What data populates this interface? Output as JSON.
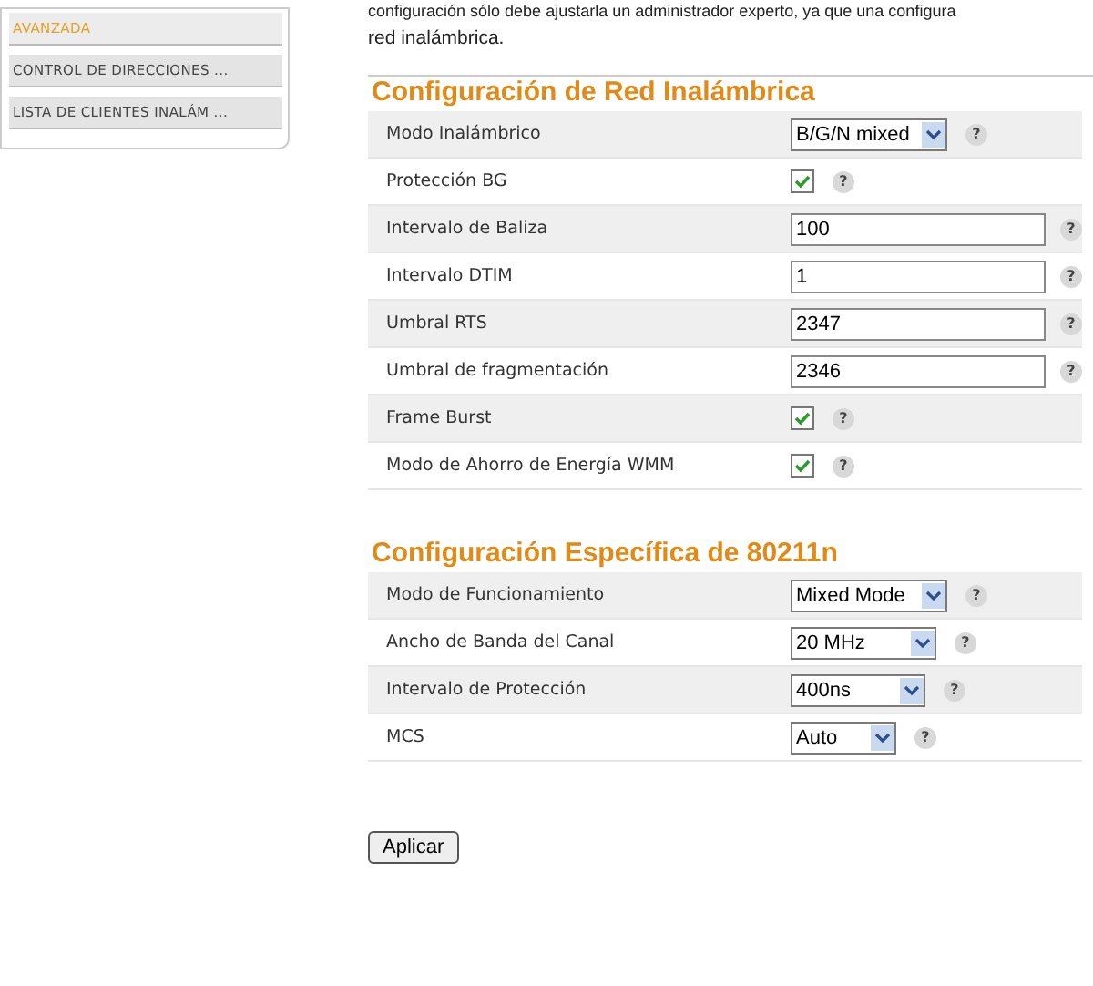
{
  "sidebar": {
    "items": [
      {
        "label": "AVANZADA",
        "selected": true
      },
      {
        "label": "CONTROL DE DIRECCIONES ...",
        "selected": false
      },
      {
        "label": "LISTA DE CLIENTES INALÁM ...",
        "selected": false
      }
    ]
  },
  "intro": {
    "lines": [
      "configuración sólo debe ajustarla un administrador experto, ya que una configura",
      "red inalámbrica."
    ]
  },
  "sections": [
    {
      "title": "Configuración de Red Inalámbrica",
      "rows": [
        {
          "label": "Modo Inalámbrico",
          "kind": "select",
          "value": "B/G/N mixed",
          "help": "?"
        },
        {
          "label": "Protección BG",
          "kind": "checkbox",
          "checked": true,
          "help": "?"
        },
        {
          "label": "Intervalo de Baliza",
          "kind": "input",
          "value": "100",
          "help": "?"
        },
        {
          "label": "Intervalo DTIM",
          "kind": "input",
          "value": "1",
          "help": "?"
        },
        {
          "label": "Umbral RTS",
          "kind": "input",
          "value": "2347",
          "help": "?"
        },
        {
          "label": "Umbral de fragmentación",
          "kind": "input",
          "value": "2346",
          "help": "?"
        },
        {
          "label": "Frame Burst",
          "kind": "checkbox",
          "checked": true,
          "help": "?"
        },
        {
          "label": "Modo de Ahorro de Energía WMM",
          "kind": "checkbox",
          "checked": true,
          "help": "?"
        }
      ]
    },
    {
      "title": "Configuración Específica de 80211n",
      "rows": [
        {
          "label": "Modo de Funcionamiento",
          "kind": "select",
          "value": "Mixed Mode",
          "help": "?"
        },
        {
          "label": "Ancho de Banda del Canal",
          "kind": "select",
          "value": "20 MHz",
          "help": "?"
        },
        {
          "label": "Intervalo de Protección",
          "kind": "select",
          "value": "400ns",
          "help": "?"
        },
        {
          "label": "MCS",
          "kind": "select",
          "value": "Auto",
          "help": "?"
        }
      ]
    }
  ],
  "apply_button": "Aplicar"
}
